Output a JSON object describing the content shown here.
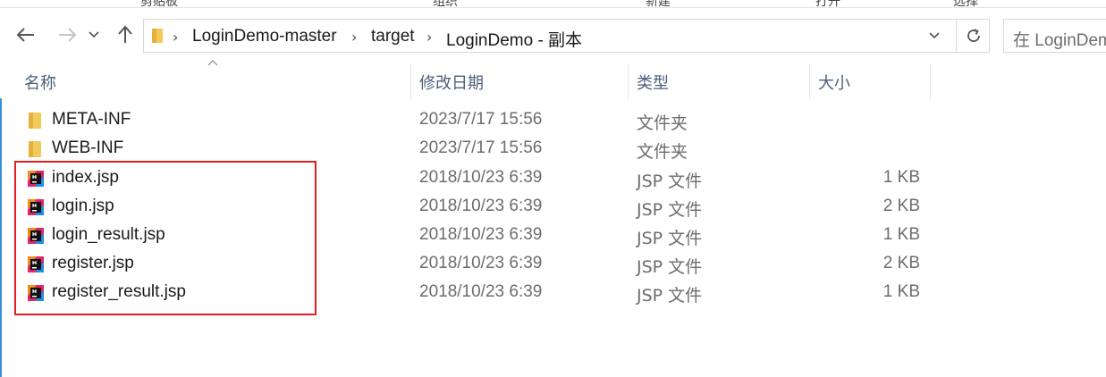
{
  "ribbon": {
    "labels": [
      "剪贴板",
      "组织",
      "新建",
      "打开",
      "选择"
    ]
  },
  "nav": {
    "back_icon": "back-arrow-icon",
    "forward_icon": "forward-arrow-icon",
    "recent_icon": "chevron-down-icon",
    "up_icon": "up-arrow-icon"
  },
  "address": {
    "segments": [
      "LoginDemo-master",
      "target",
      "LoginDemo - 副本"
    ]
  },
  "search": {
    "placeholder": "在 LoginDemo"
  },
  "columns": {
    "name": "名称",
    "date": "修改日期",
    "type": "类型",
    "size": "大小"
  },
  "files": [
    {
      "name": "META-INF",
      "date": "2023/7/17 15:56",
      "type": "文件夹",
      "size": "",
      "icon": "folder-icon"
    },
    {
      "name": "WEB-INF",
      "date": "2023/7/17 15:56",
      "type": "文件夹",
      "size": "",
      "icon": "folder-icon"
    },
    {
      "name": "index.jsp",
      "date": "2018/10/23 6:39",
      "type": "JSP 文件",
      "size": "1 KB",
      "icon": "jsp-file-icon"
    },
    {
      "name": "login.jsp",
      "date": "2018/10/23 6:39",
      "type": "JSP 文件",
      "size": "2 KB",
      "icon": "jsp-file-icon"
    },
    {
      "name": "login_result.jsp",
      "date": "2018/10/23 6:39",
      "type": "JSP 文件",
      "size": "1 KB",
      "icon": "jsp-file-icon"
    },
    {
      "name": "register.jsp",
      "date": "2018/10/23 6:39",
      "type": "JSP 文件",
      "size": "2 KB",
      "icon": "jsp-file-icon"
    },
    {
      "name": "register_result.jsp",
      "date": "2018/10/23 6:39",
      "type": "JSP 文件",
      "size": "1 KB",
      "icon": "jsp-file-icon"
    }
  ],
  "colors": {
    "header_text": "#4c607a",
    "highlight": "#e02020",
    "folder": "#f3c95a"
  }
}
